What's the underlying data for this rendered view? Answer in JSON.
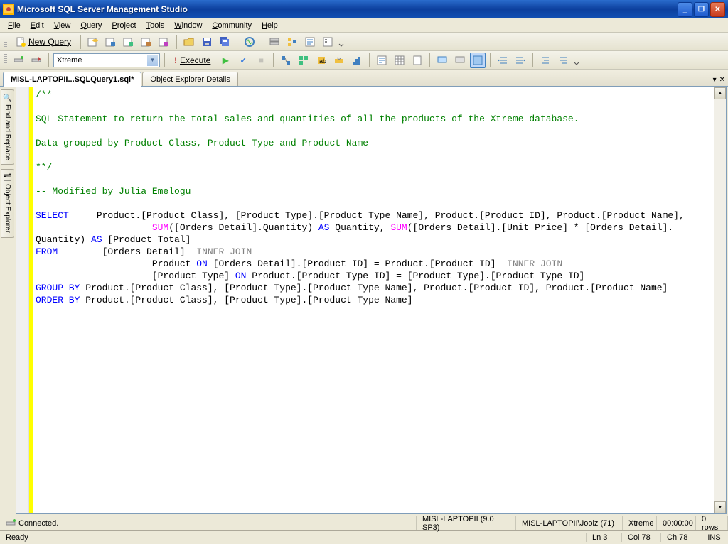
{
  "title": "Microsoft SQL Server Management Studio",
  "menu": {
    "file": "File",
    "edit": "Edit",
    "view": "View",
    "query": "Query",
    "project": "Project",
    "tools": "Tools",
    "window": "Window",
    "community": "Community",
    "help": "Help"
  },
  "toolbar": {
    "new_query": "New Query",
    "execute": "Execute",
    "db": "Xtreme"
  },
  "tabs": {
    "active": "MISL-LAPTOPII...SQLQuery1.sql*",
    "second": "Object Explorer Details"
  },
  "left_tabs": {
    "find": "Find and Replace",
    "obj": "Object Explorer"
  },
  "sql": {
    "c1": "/**",
    "c2": "SQL Statement to return the total sales and quantities of all the products of the Xtreme database.",
    "c3": "Data grouped by Product Class, Product Type and Product Name",
    "c4": "**/",
    "c5": "-- Modified by Julia Emelogu",
    "kw_select": "SELECT",
    "kw_from": "FROM",
    "kw_as": "AS",
    "kw_on": "ON",
    "kw_groupby": "GROUP BY",
    "kw_orderby": "ORDER BY",
    "fn_sum": "SUM",
    "ij": "INNER JOIN",
    "s1": "     Product.[Product Class], [Product Type].[Product Type Name], Product.[Product ID], Product.[Product Name],",
    "s2": "([Orders Detail].Quantity) ",
    "s2b": " Quantity, ",
    "s2c": "([Orders Detail].[Unit Price] * [Orders Detail].",
    "s3": "Quantity) ",
    "s3b": " [Product Total]",
    "s4": "        [Orders Detail]  ",
    "s5": "                     Product ",
    "s5b": " [Orders Detail].[Product ID] = Product.[Product ID]  ",
    "s6": "                     [Product Type] ",
    "s6b": " Product.[Product Type ID] = [Product Type].[Product Type ID]",
    "s7": " Product.[Product Class], [Product Type].[Product Type Name], Product.[Product ID], Product.[Product Name]",
    "s8": " Product.[Product Class], [Product Type].[Product Type Name]"
  },
  "conn": {
    "status": "Connected.",
    "server": "MISL-LAPTOPII (9.0 SP3)",
    "user": "MISL-LAPTOPII\\Joolz (71)",
    "db": "Xtreme",
    "time": "00:00:00",
    "rows": "0 rows"
  },
  "status": {
    "ready": "Ready",
    "ln": "Ln 3",
    "col": "Col 78",
    "ch": "Ch 78",
    "ins": "INS"
  }
}
